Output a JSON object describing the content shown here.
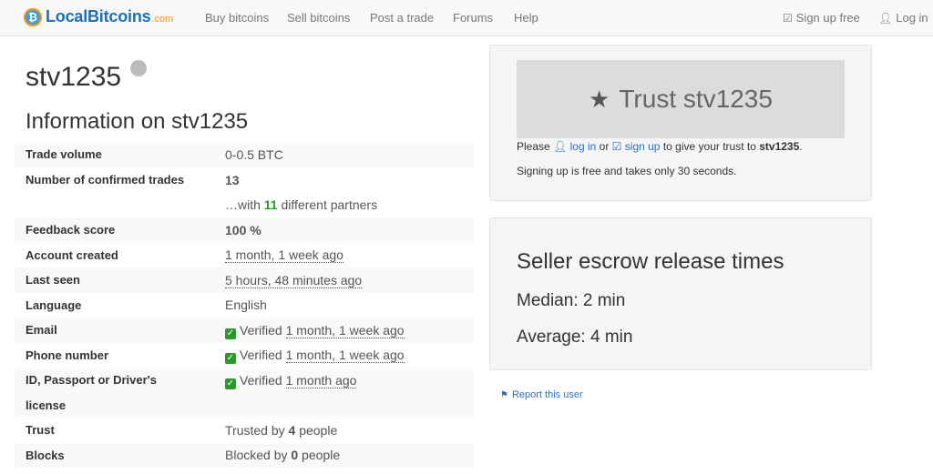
{
  "nav": {
    "brand": "LocalBitcoins",
    "brand_suffix": ".com",
    "links": [
      "Buy bitcoins",
      "Sell bitcoins",
      "Post a trade",
      "Forums",
      "Help"
    ],
    "signup": "Sign up free",
    "login": "Log in"
  },
  "profile": {
    "username": "stv1235",
    "info_heading": "Information on stv1235"
  },
  "info_rows": [
    {
      "key": "Trade volume",
      "value": "0-0.5 BTC"
    },
    {
      "key": "Number of confirmed trades",
      "value": "13"
    },
    {
      "key": "",
      "value_pre": "…with ",
      "value_num": "11",
      "value_post": " different partners"
    },
    {
      "key": "Feedback score",
      "value": "100 %"
    },
    {
      "key": "Account created",
      "value": "1 month, 1 week ago"
    },
    {
      "key": "Last seen",
      "value": "5 hours, 48 minutes ago"
    },
    {
      "key": "Language",
      "value": "English"
    },
    {
      "key": "Email",
      "verified": "Verified",
      "value": "1 month, 1 week ago"
    },
    {
      "key": "Phone number",
      "verified": "Verified",
      "value": "1 month, 1 week ago"
    },
    {
      "key": "ID, Passport or Driver's",
      "verified": "Verified",
      "value": "1 month ago"
    },
    {
      "key": "license",
      "value": ""
    },
    {
      "key": "Trust",
      "value_pre": "Trusted by ",
      "value_num": "4",
      "value_post": " people"
    },
    {
      "key": "Blocks",
      "value_pre": "Blocked by ",
      "value_num": "0",
      "value_post": " people"
    }
  ],
  "trust_panel": {
    "button_label": "Trust stv1235",
    "please": "Please",
    "log_in": "log in",
    "or": "or",
    "sign_up": "sign up",
    "give_text": "to give your trust to",
    "username": "stv1235",
    "signup_note": "Signing up is free and takes only 30 seconds."
  },
  "escrow_panel": {
    "title": "Seller escrow release times",
    "median": "Median: 2 min",
    "average": "Average: 4 min"
  },
  "report": {
    "label": "Report this user"
  }
}
